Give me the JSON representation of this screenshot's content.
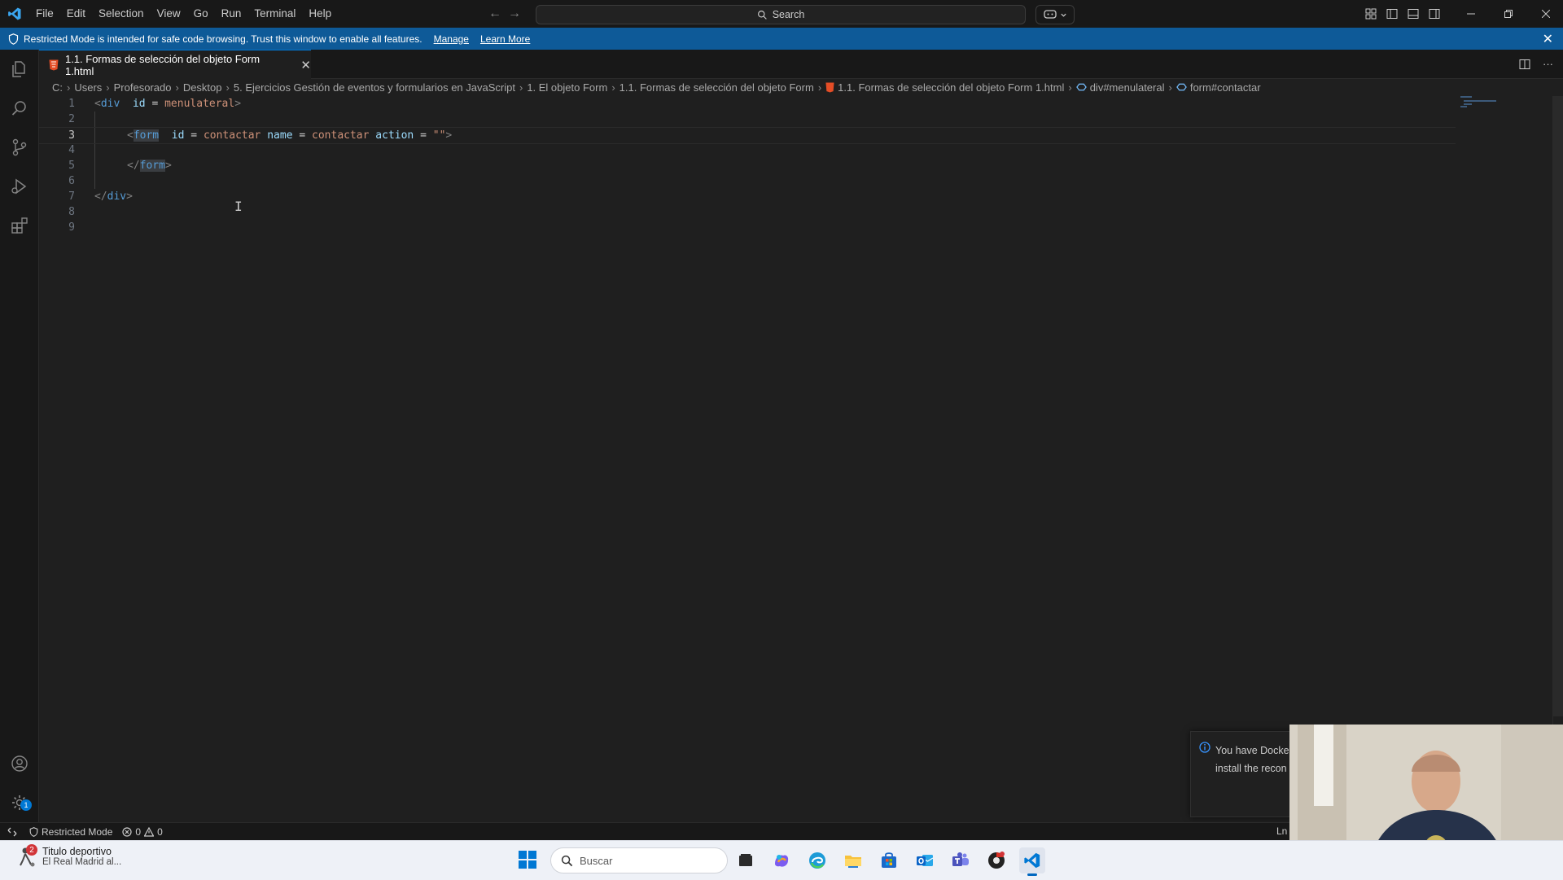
{
  "menu": [
    "File",
    "Edit",
    "Selection",
    "View",
    "Go",
    "Run",
    "Terminal",
    "Help"
  ],
  "search": {
    "label": "Search"
  },
  "banner": {
    "message": "Restricted Mode is intended for safe code browsing. Trust this window to enable all features.",
    "manage": "Manage",
    "learn_more": "Learn More",
    "color": "#0e5a98"
  },
  "tab": {
    "title": "1.1. Formas de selección del objeto Form 1.html"
  },
  "breadcrumb": [
    "C:",
    "Users",
    "Profesorado",
    "Desktop",
    "5. Ejercicios Gestión de eventos y formularios en JavaScript",
    "1. El objeto Form",
    "1.1. Formas de selección del objeto Form",
    "1.1. Formas de selección del objeto Form 1.html",
    "div#menulateral",
    "form#contactar"
  ],
  "editor": {
    "active_line": 3,
    "line_numbers": [
      "1",
      "2",
      "3",
      "4",
      "5",
      "6",
      "7",
      "8",
      "9"
    ],
    "line1": {
      "open": "<",
      "tag": "div",
      "attr_id": "id",
      "eq": "=",
      "val": "menulateral",
      "close": ">"
    },
    "line3": {
      "open": "<",
      "tag": "form",
      "attr_id": "id",
      "val_id": "contactar",
      "attr_name": "name",
      "val_name": "contactar",
      "attr_action": "action",
      "val_action": "\"\"",
      "eq": "=",
      "close": ">"
    },
    "line5": {
      "open": "</",
      "tag": "form",
      "close": ">"
    },
    "line7": {
      "open": "</",
      "tag": "div",
      "close": ">"
    }
  },
  "notification": {
    "line1": "You have Docke",
    "line2": "install the recon"
  },
  "status": {
    "restricted": "Restricted Mode",
    "errors": "0",
    "warnings": "0",
    "position": "Ln"
  },
  "taskbar": {
    "weather_badge": "2",
    "weather_title": "Titulo deportivo",
    "weather_sub": "El Real Madrid al...",
    "search_placeholder": "Buscar"
  },
  "activity": {
    "settings_badge": "1"
  },
  "icons": {
    "activity": [
      "explorer-icon",
      "search-icon",
      "source-control-icon",
      "run-debug-icon",
      "extensions-icon"
    ],
    "activity_bottom": [
      "accounts-icon",
      "manage-gear-icon"
    ],
    "taskbar": [
      "start-icon",
      "task-view-icon",
      "copilot-icon",
      "edge-icon",
      "file-explorer-icon",
      "store-icon",
      "outlook-icon",
      "teams-icon",
      "chrome-icon",
      "vscode-icon"
    ]
  }
}
